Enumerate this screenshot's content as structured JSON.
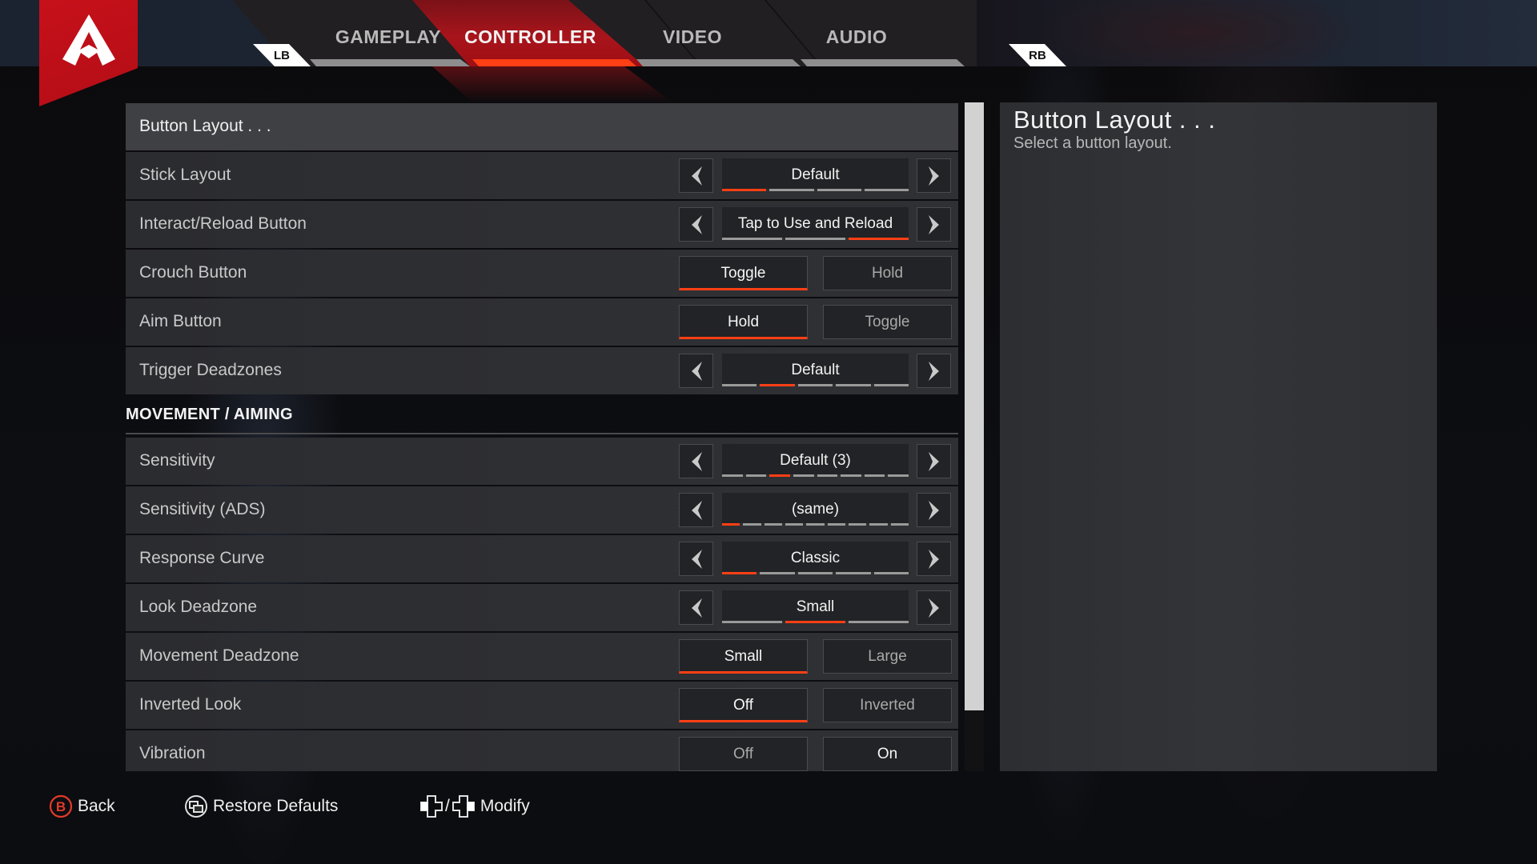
{
  "brand": {
    "logo": "apex-legends-logo",
    "accent_color": "#ff3f14",
    "logo_color": "#c7101a"
  },
  "nav": {
    "left_bumper": "LB",
    "right_bumper": "RB",
    "tabs": [
      {
        "label": "GAMEPLAY",
        "active": false
      },
      {
        "label": "CONTROLLER",
        "active": true
      },
      {
        "label": "VIDEO",
        "active": false
      },
      {
        "label": "AUDIO",
        "active": false
      }
    ]
  },
  "settings": {
    "rows_top": [
      {
        "label": "Button Layout . . .",
        "type": "link",
        "selected": true
      },
      {
        "label": "Stick Layout",
        "type": "selector",
        "value": "Default",
        "segments": 4,
        "active_segment": 1
      },
      {
        "label": "Interact/Reload Button",
        "type": "selector",
        "value": "Tap to Use and Reload",
        "segments": 3,
        "active_segment": 3
      },
      {
        "label": "Crouch Button",
        "type": "toggle",
        "options": [
          "Toggle",
          "Hold"
        ],
        "selected": "Toggle"
      },
      {
        "label": "Aim Button",
        "type": "toggle",
        "options": [
          "Hold",
          "Toggle"
        ],
        "selected": "Hold"
      },
      {
        "label": "Trigger Deadzones",
        "type": "selector",
        "value": "Default",
        "segments": 5,
        "active_segment": 2
      }
    ],
    "section_title": "MOVEMENT / AIMING",
    "rows_movement": [
      {
        "label": "Sensitivity",
        "type": "selector",
        "value": "Default (3)",
        "segments": 8,
        "active_segment": 3
      },
      {
        "label": "Sensitivity  (ADS)",
        "type": "selector",
        "value": "(same)",
        "segments": 9,
        "active_segment": 1
      },
      {
        "label": "Response Curve",
        "type": "selector",
        "value": "Classic",
        "segments": 5,
        "active_segment": 1
      },
      {
        "label": "Look Deadzone",
        "type": "selector",
        "value": "Small",
        "segments": 3,
        "active_segment": 2
      },
      {
        "label": "Movement Deadzone",
        "type": "toggle",
        "options": [
          "Small",
          "Large"
        ],
        "selected": "Small"
      },
      {
        "label": "Inverted Look",
        "type": "toggle",
        "options": [
          "Off",
          "Inverted"
        ],
        "selected": "Off"
      },
      {
        "label": "Vibration",
        "type": "toggle",
        "options": [
          "Off",
          "On"
        ],
        "selected": "On"
      }
    ]
  },
  "scrollbar": {
    "visible_fraction": 0.91,
    "position": 0.0
  },
  "detail": {
    "title": "Button Layout . . .",
    "description": "Select a button layout."
  },
  "footer": {
    "back": {
      "icon": "b-button-icon",
      "label": "Back"
    },
    "restore": {
      "icon": "view-button-icon",
      "label": "Restore Defaults"
    },
    "modify": {
      "icon": "dpad-left-right-icon",
      "separator": "/",
      "label": "Modify"
    }
  }
}
